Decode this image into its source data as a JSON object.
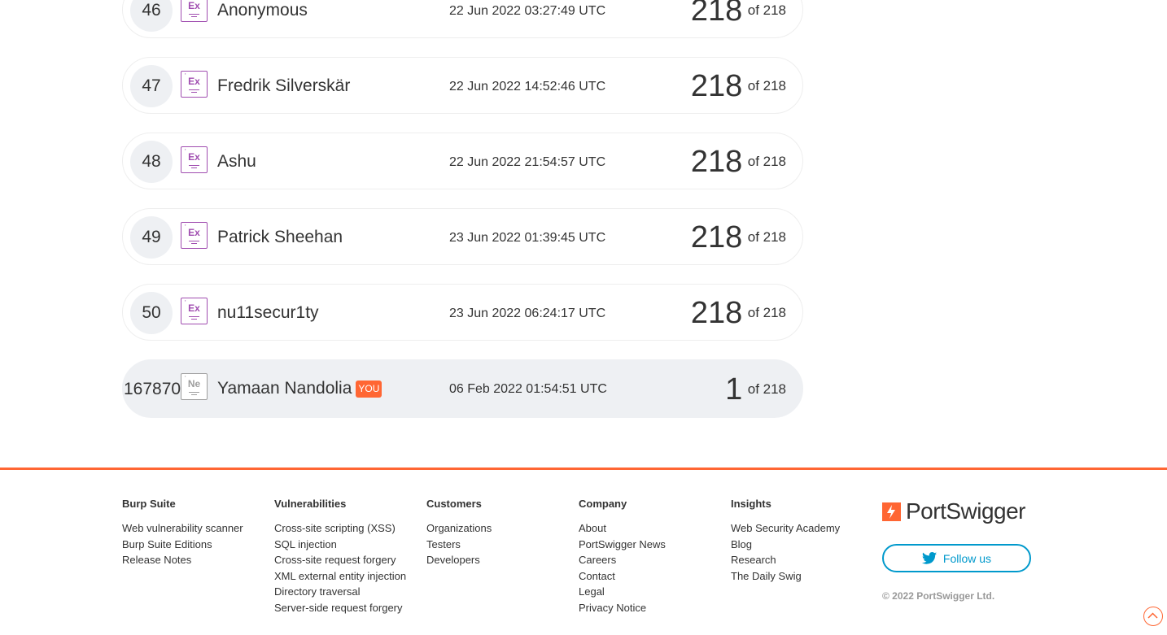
{
  "leaderboard": {
    "rows": [
      {
        "rank": "46",
        "level": "Ex",
        "name": "Anonymous",
        "date": "22 Jun 2022 03:27:49 UTC",
        "score": "218",
        "total": "of 218"
      },
      {
        "rank": "47",
        "level": "Ex",
        "name": "Fredrik Silverskär",
        "date": "22 Jun 2022 14:52:46 UTC",
        "score": "218",
        "total": "of 218"
      },
      {
        "rank": "48",
        "level": "Ex",
        "name": "Ashu",
        "date": "22 Jun 2022 21:54:57 UTC",
        "score": "218",
        "total": "of 218"
      },
      {
        "rank": "49",
        "level": "Ex",
        "name": "Patrick Sheehan",
        "date": "23 Jun 2022 01:39:45 UTC",
        "score": "218",
        "total": "of 218"
      },
      {
        "rank": "50",
        "level": "Ex",
        "name": "nu11secur1ty",
        "date": "23 Jun 2022 06:24:17 UTC",
        "score": "218",
        "total": "of 218"
      }
    ],
    "current_user": {
      "rank": "167870",
      "level": "Ne",
      "name": "Yamaan Nandolia",
      "you_label": "YOU",
      "date": "06 Feb 2022 01:54:51 UTC",
      "score": "1",
      "total": "of 218"
    }
  },
  "footer": {
    "columns": [
      {
        "heading": "Burp Suite",
        "links": [
          "Web vulnerability scanner",
          "Burp Suite Editions",
          "Release Notes"
        ]
      },
      {
        "heading": "Vulnerabilities",
        "links": [
          "Cross-site scripting (XSS)",
          "SQL injection",
          "Cross-site request forgery",
          "XML external entity injection",
          "Directory traversal",
          "Server-side request forgery"
        ]
      },
      {
        "heading": "Customers",
        "links": [
          "Organizations",
          "Testers",
          "Developers"
        ]
      },
      {
        "heading": "Company",
        "links": [
          "About",
          "PortSwigger News",
          "Careers",
          "Contact",
          "Legal",
          "Privacy Notice"
        ]
      },
      {
        "heading": "Insights",
        "links": [
          "Web Security Academy",
          "Blog",
          "Research",
          "The Daily Swig"
        ]
      }
    ],
    "brand": "PortSwigger",
    "follow_label": "Follow us",
    "copyright": "© 2022 PortSwigger Ltd."
  },
  "colors": {
    "accent": "#ff6633",
    "expert_badge": "#a04db0",
    "twitter": "#0099cc"
  },
  "icons": {
    "follow": "twitter-bird-icon",
    "back_to_top": "chevron-up-icon",
    "logo": "portswigger-logo-icon"
  }
}
